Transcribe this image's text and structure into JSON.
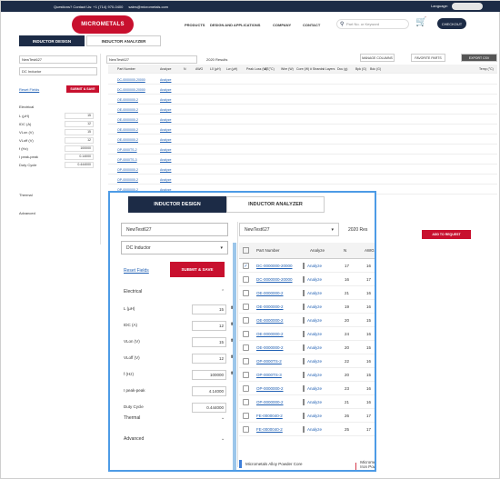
{
  "topbar": {
    "question": "Questions? Contact Us: +1 (714) 970-0400",
    "email": "sales@micrometals.com",
    "language": "Language:"
  },
  "logo": {
    "text": "MICROMETALS"
  },
  "nav": {
    "items": [
      "PRODUCTS",
      "DESIGN AND APPLICATIONS",
      "COMPANY",
      "CONTACT"
    ],
    "search_placeholder": "Part No. or Keyword",
    "checkout": "CHECKOUT"
  },
  "bg_tabs": {
    "design": "INDUCTOR DESIGN",
    "analyzer": "INDUCTOR ANALYZER"
  },
  "bg_toolbar": {
    "manage_columns": "MANAGE COLUMNS",
    "favorites": "FAVORITE PARTS",
    "export": "EXPORT CSV",
    "results": "2020 Results",
    "dropdown": "NewTest627"
  },
  "bg_sidebar": {
    "name": "NewTest627",
    "type": "DC Inductor",
    "reset": "Reset Fields",
    "submit": "SUBMIT & SAVE",
    "electrical": "Electrical",
    "thermal": "Thermal",
    "advanced": "Advanced",
    "params": [
      {
        "label": "L (µH)",
        "value": "15"
      },
      {
        "label": "IDC (A)",
        "value": "12"
      },
      {
        "label": "VLon (V)",
        "value": "15"
      },
      {
        "label": "VLoff (V)",
        "value": "12"
      },
      {
        "label": "f (Hz)",
        "value": "100000"
      },
      {
        "label": "I peak-peak",
        "value": "0.14000"
      },
      {
        "label": "Duty Cycle",
        "value": "0.444000"
      }
    ]
  },
  "bg_table": {
    "headers": [
      "Part Number",
      "Analyze",
      "N",
      "AWG",
      "L0 (µH)",
      "Lw (µH)",
      "Peak Loss (W)",
      "ΔT(°C)",
      "Wire (W)",
      "Core (W)",
      "# Strands",
      "# Layers",
      "Dcu (g)",
      "Bpk (G)",
      "Bdc (G)",
      "Temp (°C)"
    ],
    "rows": [
      "DC-0000000-20000",
      "DC-0000000-20000",
      "OE-0000000-2",
      "OE-0000000-2",
      "OE-0000000-2",
      "OE-0000000-2",
      "OE-0000000-2",
      "OP-0000TS-2",
      "OP-0000TS-3",
      "OP-0000000-2",
      "OP-0000000-2",
      "OP-0000000-2"
    ],
    "analyze": "Analyze"
  },
  "overlay": {
    "tab_design": "INDUCTOR DESIGN",
    "tab_analyzer": "INDUCTOR ANALYZER",
    "name_field": "NewTest627",
    "type_field": "DC Inductor",
    "right_dropdown": "NewTest627",
    "results": "2020 Res",
    "reset": "Reset Fields",
    "submit": "SUBMIT & SAVE",
    "electrical": "Electrical",
    "thermal": "Thermal",
    "advanced": "Advanced",
    "params": [
      {
        "label": "L (µH)",
        "value": "15"
      },
      {
        "label": "IDC (A)",
        "value": "12"
      },
      {
        "label": "VLon (V)",
        "value": "15"
      },
      {
        "label": "VLoff (V)",
        "value": "12"
      },
      {
        "label": "f (Hz)",
        "value": "100000"
      },
      {
        "label": "I peak-peak",
        "value": "4.14000"
      },
      {
        "label": "Duty Cycle",
        "value": "0.444000"
      }
    ],
    "table_headers": {
      "part": "Part Number",
      "analyze": "Analyze",
      "n": "N",
      "awg": "AWG"
    },
    "rows": [
      {
        "part": "DC-0000000-20000",
        "analyze": "Analyze",
        "n": "17",
        "awg": "16",
        "checked": true
      },
      {
        "part": "DC-0000000-20000",
        "analyze": "Analyze",
        "n": "16",
        "awg": "17",
        "checked": false
      },
      {
        "part": "OE-0000000-2",
        "analyze": "Analyze",
        "n": "21",
        "awg": "16",
        "checked": false
      },
      {
        "part": "OE-0000000-2",
        "analyze": "Analyze",
        "n": "19",
        "awg": "16",
        "checked": false
      },
      {
        "part": "OE-0000000-2",
        "analyze": "Analyze",
        "n": "20",
        "awg": "15",
        "checked": false
      },
      {
        "part": "OE-0000000-2",
        "analyze": "Analyze",
        "n": "24",
        "awg": "16",
        "checked": false
      },
      {
        "part": "OE-0000000-2",
        "analyze": "Analyze",
        "n": "20",
        "awg": "15",
        "checked": false
      },
      {
        "part": "OP-0000TS-2",
        "analyze": "Analyze",
        "n": "22",
        "awg": "16",
        "checked": false
      },
      {
        "part": "OP-0000TS-3",
        "analyze": "Analyze",
        "n": "20",
        "awg": "15",
        "checked": false
      },
      {
        "part": "OP-0000000-2",
        "analyze": "Analyze",
        "n": "23",
        "awg": "16",
        "checked": false
      },
      {
        "part": "OP-0000000-2",
        "analyze": "Analyze",
        "n": "21",
        "awg": "16",
        "checked": false
      },
      {
        "part": "FE-0000040-2",
        "analyze": "Analyze",
        "n": "26",
        "awg": "17",
        "checked": false
      },
      {
        "part": "FE-0000040-2",
        "analyze": "Analyze",
        "n": "25",
        "awg": "17",
        "checked": false
      }
    ],
    "legend": [
      "Micrometals Alloy Powder Core",
      "Micrometals Iron Powder Core"
    ],
    "legend_colors": [
      "#3d7fd9",
      "#d63a4a"
    ]
  },
  "add_request": "ADD TO REQUEST"
}
